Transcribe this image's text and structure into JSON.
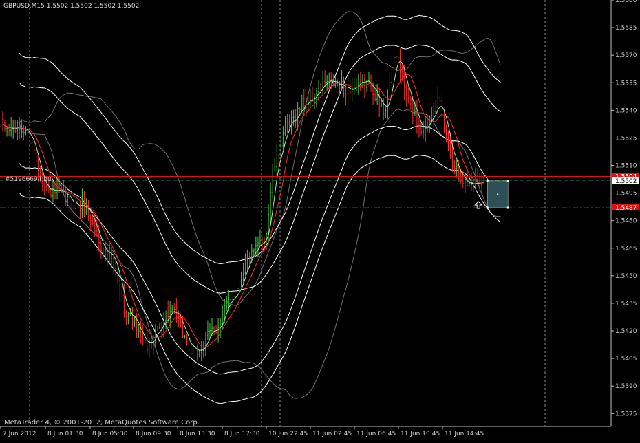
{
  "header": {
    "symbol_line": "GBPUSD,M15  1.5502 1.5502 1.5502 1.5502"
  },
  "footer": {
    "copyright": "MetaTrader 4, © 2001-2012, MetaQuotes Software Corp."
  },
  "order": {
    "label": "#51966694 buy",
    "price": 1.5502,
    "price_label": "1.5502",
    "stop_price": 1.5487,
    "stop_label": "1.5487",
    "red_line_price": 1.5504,
    "red_tag_label": "1.5504"
  },
  "colors": {
    "background": "#000000",
    "axis": "#c0c0c0",
    "grid": "#8a8a8a",
    "bull": "#3fd13f",
    "bear": "#ff3030",
    "ma_fast": "#ff2a2a",
    "ma_green": "#a8f0a0",
    "envelope": "#ffffff",
    "bollinger": "#707070",
    "order_line": "#2fae2f",
    "stop_line": "#e01010",
    "box_fill": "#2e4f55"
  },
  "chart_data": {
    "type": "candlestick",
    "symbol": "GBPUSD",
    "timeframe": "M15",
    "ylim": [
      1.5368,
      1.56
    ],
    "y_ticks": [
      1.56,
      1.5585,
      1.557,
      1.5555,
      1.554,
      1.5525,
      1.551,
      1.5495,
      1.548,
      1.5465,
      1.545,
      1.5435,
      1.542,
      1.5405,
      1.539,
      1.5375
    ],
    "y_tick_labels": [
      "1.5600",
      "1.5585",
      "1.5570",
      "1.5555",
      "1.5540",
      "1.5525",
      "1.5510",
      "1.5495",
      "1.5480",
      "1.5465",
      "1.5450",
      "1.5435",
      "1.5420",
      "1.5405",
      "1.5390",
      "1.5375"
    ],
    "x_tick_labels": [
      "7 Jun 2012",
      "8 Jun 01:30",
      "8 Jun 05:30",
      "8 Jun 09:30",
      "8 Jun 13:30",
      "8 Jun 17:30",
      "10 Jun 22:45",
      "11 Jun 02:45",
      "11 Jun 06:45",
      "11 Jun 10:45",
      "11 Jun 14:45"
    ],
    "grid": "vertical-dashed",
    "key_points": [
      {
        "bar": 0,
        "price": 1.553
      },
      {
        "bar": 10,
        "price": 1.553
      },
      {
        "bar": 22,
        "price": 1.5496
      },
      {
        "bar": 38,
        "price": 1.5488
      },
      {
        "bar": 50,
        "price": 1.5462
      },
      {
        "bar": 60,
        "price": 1.543
      },
      {
        "bar": 68,
        "price": 1.5412
      },
      {
        "bar": 80,
        "price": 1.543
      },
      {
        "bar": 92,
        "price": 1.5408
      },
      {
        "bar": 102,
        "price": 1.5422
      },
      {
        "bar": 110,
        "price": 1.544
      },
      {
        "bar": 118,
        "price": 1.546
      },
      {
        "bar": 125,
        "price": 1.547
      },
      {
        "bar": 130,
        "price": 1.551
      },
      {
        "bar": 135,
        "price": 1.553
      },
      {
        "bar": 145,
        "price": 1.5545
      },
      {
        "bar": 155,
        "price": 1.5555
      },
      {
        "bar": 165,
        "price": 1.5552
      },
      {
        "bar": 175,
        "price": 1.5555
      },
      {
        "bar": 182,
        "price": 1.554
      },
      {
        "bar": 188,
        "price": 1.557
      },
      {
        "bar": 194,
        "price": 1.5545
      },
      {
        "bar": 200,
        "price": 1.553
      },
      {
        "bar": 208,
        "price": 1.5545
      },
      {
        "bar": 212,
        "price": 1.5525
      },
      {
        "bar": 216,
        "price": 1.551
      },
      {
        "bar": 222,
        "price": 1.55
      },
      {
        "bar": 230,
        "price": 1.5502
      }
    ]
  }
}
